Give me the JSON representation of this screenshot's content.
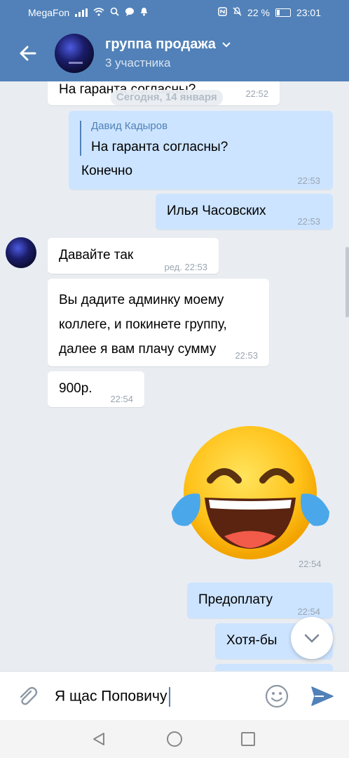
{
  "status": {
    "carrier": "MegaFon",
    "battery": "22 %",
    "time": "23:01"
  },
  "header": {
    "title": "группа продажа",
    "subtitle": "3 участника"
  },
  "date_separator": "Сегодня, 14 января",
  "messages": [
    {
      "dir": "in",
      "text": "На гаранта согласны?",
      "time": "22:52"
    },
    {
      "dir": "out",
      "reply_author": "Давид Кадыров",
      "reply_text": "На гаранта согласны?",
      "text": "Конечно",
      "time": "22:53"
    },
    {
      "dir": "out",
      "text": "Илья Часовских",
      "time": "22:53"
    },
    {
      "dir": "in",
      "text": "Давайте так",
      "time": "ред. 22:53"
    },
    {
      "dir": "in",
      "text": "Вы дадите админку моему коллеге, и покинете группу, далее я вам плачу сумму",
      "time": "22:53"
    },
    {
      "dir": "in",
      "text": "900р.",
      "time": "22:54"
    },
    {
      "dir": "out",
      "sticker": "laughing-tears-emoji",
      "time": "22:54"
    },
    {
      "dir": "out",
      "text": "Предоплату",
      "time": "22:54"
    },
    {
      "dir": "out",
      "text": "Хотя-бы"
    }
  ],
  "input": {
    "value": "Я щас Поповичу"
  },
  "colors": {
    "accent": "#5181b8",
    "outgoing": "#cce4ff",
    "incoming": "#ffffff",
    "background": "#e9edf2"
  }
}
